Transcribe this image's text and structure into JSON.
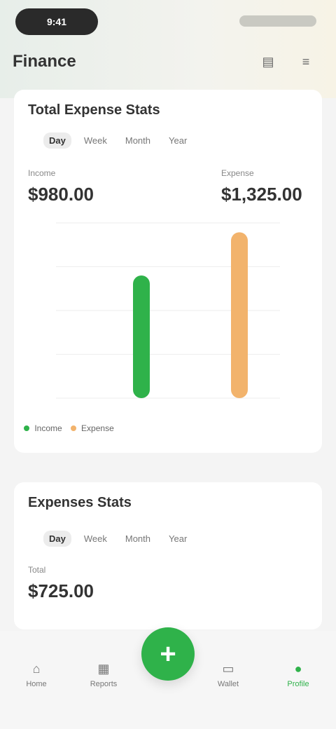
{
  "statusBar": {
    "pill": "9:41"
  },
  "header": {
    "title": "Finance",
    "icons": [
      "chart-icon",
      "menu-icon"
    ]
  },
  "card1": {
    "title": "Total Expense Stats",
    "tabs": [
      "Day",
      "Week",
      "Month",
      "Year"
    ],
    "leftStatLabel": "Income",
    "leftStatValue": "$980.00",
    "rightStatLabel": "Expense",
    "rightStatValue": "$1,325.00",
    "legend": {
      "income": "Income",
      "expense": "Expense"
    }
  },
  "chart_data": {
    "type": "bar",
    "categories": [
      "Income",
      "Expense"
    ],
    "values": [
      980,
      1325
    ],
    "ylim": [
      0,
      1400
    ],
    "ylabel": "",
    "xlabel": ""
  },
  "card2": {
    "title": "Expenses Stats",
    "tabs": [
      "Day",
      "Week",
      "Month",
      "Year"
    ],
    "statLabel": "Total",
    "statValue": "$725.00"
  },
  "nav": {
    "items": [
      {
        "label": "Home",
        "icon": "home-icon"
      },
      {
        "label": "Reports",
        "icon": "report-icon"
      },
      {
        "label": "Wallet",
        "icon": "wallet-icon"
      },
      {
        "label": "Profile",
        "icon": "user-icon"
      }
    ],
    "fab": "+"
  },
  "colors": {
    "green": "#2fb24a",
    "orange": "#f2b36c",
    "textDark": "#333333",
    "textMuted": "#777777"
  }
}
